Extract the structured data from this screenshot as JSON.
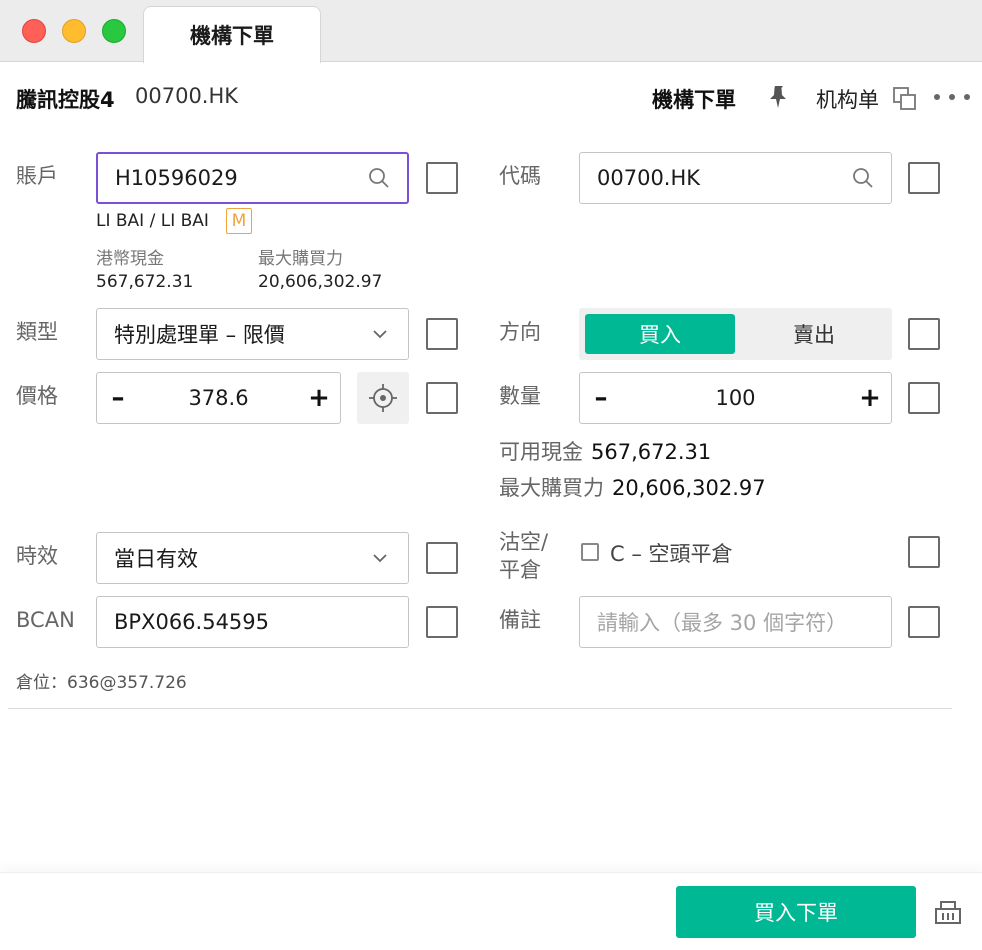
{
  "window": {
    "tab_title": "機構下單"
  },
  "header": {
    "stock_name": "騰訊控股4",
    "stock_code": "00700.HK",
    "title": "機構下單",
    "jgd_label": "机构单"
  },
  "account": {
    "label": "賬戶",
    "value": "H10596029",
    "holder": "LI BAI / LI BAI",
    "badge": "M",
    "cash_label": "港幣現金",
    "cash_value": "567,672.31",
    "power_label": "最大購買力",
    "power_value": "20,606,302.97"
  },
  "code": {
    "label": "代碼",
    "value": "00700.HK"
  },
  "type": {
    "label": "類型",
    "value": "特別處理單 – 限價"
  },
  "direction": {
    "label": "方向",
    "buy": "買入",
    "sell": "賣出",
    "selected": "買入"
  },
  "price": {
    "label": "價格",
    "minus": "–",
    "value": "378.6",
    "plus": "+"
  },
  "quantity": {
    "label": "數量",
    "minus": "–",
    "value": "100",
    "plus": "+"
  },
  "available": {
    "cash_label": "可用現金",
    "cash_value": "567,672.31",
    "power_label": "最大購買力",
    "power_value": "20,606,302.97"
  },
  "validity": {
    "label": "時效",
    "value": "當日有效"
  },
  "short": {
    "label_line1": "沽空/",
    "label_line2": "平倉",
    "option": "C – 空頭平倉"
  },
  "bcan": {
    "label": "BCAN",
    "value": "BPX066.54595"
  },
  "remark": {
    "label": "備註",
    "placeholder": "請輸入（最多 30 個字符）"
  },
  "position": {
    "text": "倉位：636@357.726"
  },
  "footer": {
    "order_button": "買入下單"
  },
  "colors": {
    "accent_green": "#00b894",
    "focus_purple": "#7b4fd6",
    "badge_orange": "#f0a43a"
  }
}
